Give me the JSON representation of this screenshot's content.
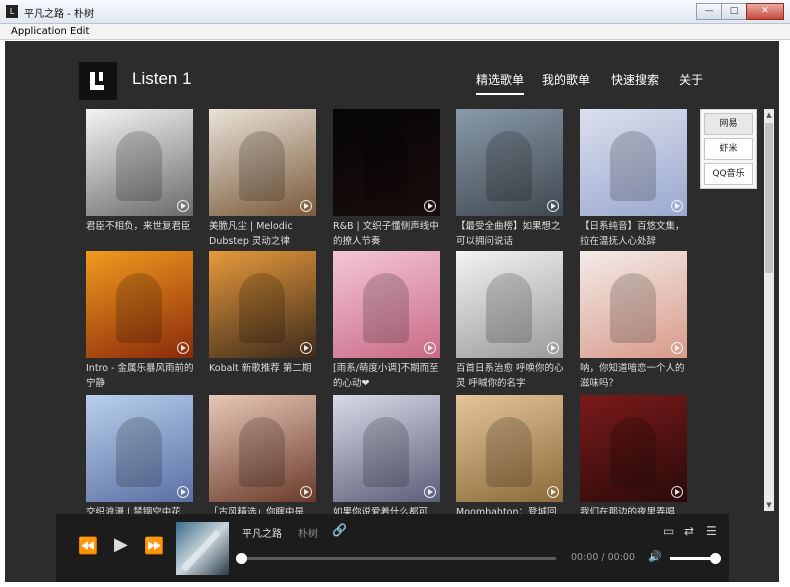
{
  "window": {
    "title": "平凡之路 - 朴树",
    "min": "—",
    "max": "□",
    "close": "✕"
  },
  "menubar": [
    "Application",
    "Edit"
  ],
  "header": {
    "app_title": "Listen 1",
    "nav": [
      "精选歌单",
      "我的歌单",
      "快速搜索",
      "关于"
    ]
  },
  "sources": [
    "网易",
    "虾米",
    "QQ音乐"
  ],
  "grid": [
    {
      "caption": "君臣不相负，来世复君臣",
      "colors": [
        "#f4f4f4",
        "#6a6a6a"
      ]
    },
    {
      "caption": "美脆凡尘 | Melodic Dubstep 灵动之律",
      "colors": [
        "#e9e2d8",
        "#7a5a3a"
      ]
    },
    {
      "caption": "R&B | 文织子懂侧声线中的撩人节奏",
      "colors": [
        "#050505",
        "#1a0d0d"
      ]
    },
    {
      "caption": "【最受全曲榜】如果想之可以拥问说话",
      "colors": [
        "#8a9aa8",
        "#3e4850"
      ]
    },
    {
      "caption": "【日系纯音】百悠文集，拉在温抚人心处辞",
      "colors": [
        "#dbe0ee",
        "#9aa8cf"
      ]
    },
    {
      "caption": "Intro - 金属乐暴风雨前的宁静",
      "colors": [
        "#f29a1e",
        "#8a2a0a"
      ]
    },
    {
      "caption": "Kobalt 新歌推荐 第二期",
      "colors": [
        "#e79a3c",
        "#3d2a1a"
      ]
    },
    {
      "caption": "[雨系/萌度小调]不期而至的心动❤",
      "colors": [
        "#f4c7d6",
        "#c86a86"
      ]
    },
    {
      "caption": "百首日系治愈 呼唤你的心灵 呼喊你的名字",
      "colors": [
        "#f3f3f3",
        "#9a9a9a"
      ]
    },
    {
      "caption": "呐，你知道喑恋一个人的滋味吗？",
      "colors": [
        "#f3ece8",
        "#d89a8a"
      ]
    },
    {
      "caption": "交织浪漫 | 禁锢空中花",
      "colors": [
        "#b8d0ec",
        "#5a6fa3"
      ]
    },
    {
      "caption": "「古风精选」你瞎中是",
      "colors": [
        "#e8c8b8",
        "#6a3a2a"
      ]
    },
    {
      "caption": "如果你说爱着什么都可",
      "colors": [
        "#d8dae6",
        "#5a5e78"
      ]
    },
    {
      "caption": "Moombahton：登城回",
      "colors": [
        "#e6c49a",
        "#8a6a3a"
      ]
    },
    {
      "caption": "我们在那边的夜里弄唱",
      "colors": [
        "#7a1a1a",
        "#2a0a0a"
      ]
    }
  ],
  "player": {
    "track_title": "平凡之路",
    "artist": "朴树",
    "time": "00:00 / 00:00",
    "progress": 0,
    "volume": 0.9,
    "icons": [
      "prev-icon",
      "play-icon",
      "next-icon",
      "link-icon",
      "folder-icon",
      "repeat-icon",
      "playlist-icon",
      "volume-icon"
    ]
  }
}
